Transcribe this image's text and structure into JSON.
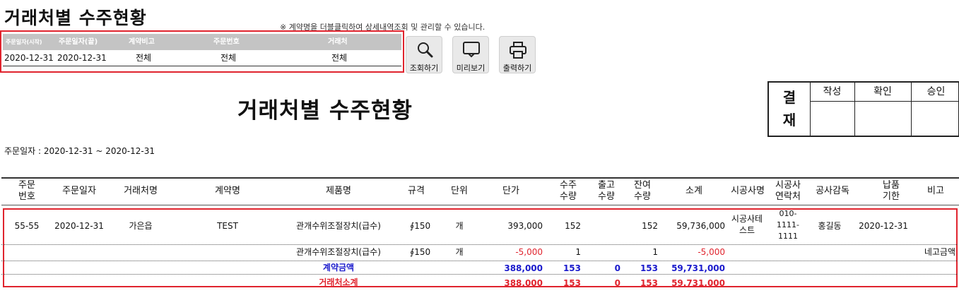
{
  "page_title": "거래처별 수주현황",
  "notice": "※ 계약명을 더블클릭하여 상세내역조회 및 관리할 수 있습니다.",
  "filter": {
    "headers": [
      "주문일자(시작)",
      "주문일자(끝)",
      "계약비고",
      "주문번호",
      "거래처"
    ],
    "values": [
      "2020-12-31",
      "2020-12-31",
      "전체",
      "전체",
      "전체"
    ]
  },
  "toolbar": {
    "search_label": "조회하기",
    "preview_label": "미리보기",
    "print_label": "출력하기"
  },
  "report": {
    "title": "거래처별 수주현황",
    "date_range": "주문일자 : 2020-12-31 ~ 2020-12-31"
  },
  "approval": {
    "label": "결\n재",
    "columns": [
      "작성",
      "확인",
      "승인"
    ]
  },
  "table": {
    "headers": [
      "주문\n번호",
      "주문일자",
      "거래처명",
      "계약명",
      "제품명",
      "규격",
      "단위",
      "단가",
      "수주\n수량",
      "출고\n수량",
      "잔여\n수량",
      "소계",
      "시공사명",
      "시공사\n연락처",
      "공사감독",
      "납품\n기한",
      "비고"
    ],
    "rows": [
      {
        "order_no": "55-55",
        "order_date": "2020-12-31",
        "client": "가은읍",
        "contract": "TEST",
        "product": "관개수위조절장치(급수)",
        "spec": "∮150",
        "unit": "개",
        "price": "393,000",
        "order_qty": "152",
        "out_qty": "",
        "remain_qty": "152",
        "subtotal": "59,736,000",
        "contractor": "시공사테\n스트",
        "contractor_phone": "010-\n1111-\n1111",
        "supervisor": "홍길동",
        "due_date": "2020-12-31",
        "note": ""
      },
      {
        "order_no": "",
        "order_date": "",
        "client": "",
        "contract": "",
        "product": "관개수위조절장치(급수)",
        "spec": "∮150",
        "unit": "개",
        "price": "-5,000",
        "order_qty": "1",
        "out_qty": "",
        "remain_qty": "1",
        "subtotal": "-5,000",
        "contractor": "",
        "contractor_phone": "",
        "supervisor": "",
        "due_date": "",
        "note": "네고금액"
      }
    ],
    "contract_total": {
      "label": "계약금액",
      "price": "388,000",
      "order_qty": "153",
      "out_qty": "0",
      "remain_qty": "153",
      "subtotal": "59,731,000"
    },
    "client_total": {
      "label": "거래처소계",
      "price": "388,000",
      "order_qty": "153",
      "out_qty": "0",
      "remain_qty": "153",
      "subtotal": "59,731,000"
    }
  },
  "colors": {
    "accent_red": "#e0242e",
    "total_blue": "#1a1acc",
    "filter_header_bg": "#c4c4c4",
    "button_bg": "#e9e9e9"
  }
}
